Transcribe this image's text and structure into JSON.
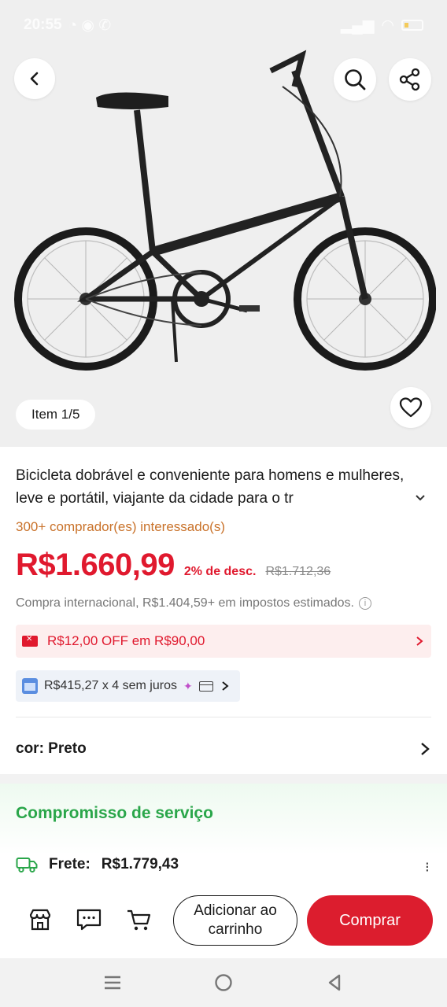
{
  "status_bar": {
    "time": "20:55"
  },
  "gallery": {
    "counter": "Item 1/5"
  },
  "product": {
    "title": "Bicicleta dobrável e conveniente para homens e mulheres, leve e portátil, viajante da cidade para o tr",
    "interest": "300+ comprador(es) interessado(s)",
    "price": "R$1.660,99",
    "discount": "2% de desc.",
    "old_price": "R$1.712,36",
    "tax_note": "Compra internacional, R$1.404,59+ em impostos estimados."
  },
  "coupon": {
    "label": "R$12,00 OFF em R$90,00"
  },
  "installment": {
    "label": "R$415,27 x 4 sem juros"
  },
  "variant": {
    "label": "cor: Preto"
  },
  "service": {
    "title": "Compromisso de serviço",
    "shipping_label": "Frete:",
    "shipping_value": "R$1.779,43"
  },
  "actions": {
    "add_to_cart": "Adicionar ao carrinho",
    "buy": "Comprar"
  },
  "colors": {
    "price_red": "#e0192e",
    "buy_button": "#dc1d2e",
    "service_green": "#2aa64a",
    "interest_orange": "#c9722a"
  }
}
